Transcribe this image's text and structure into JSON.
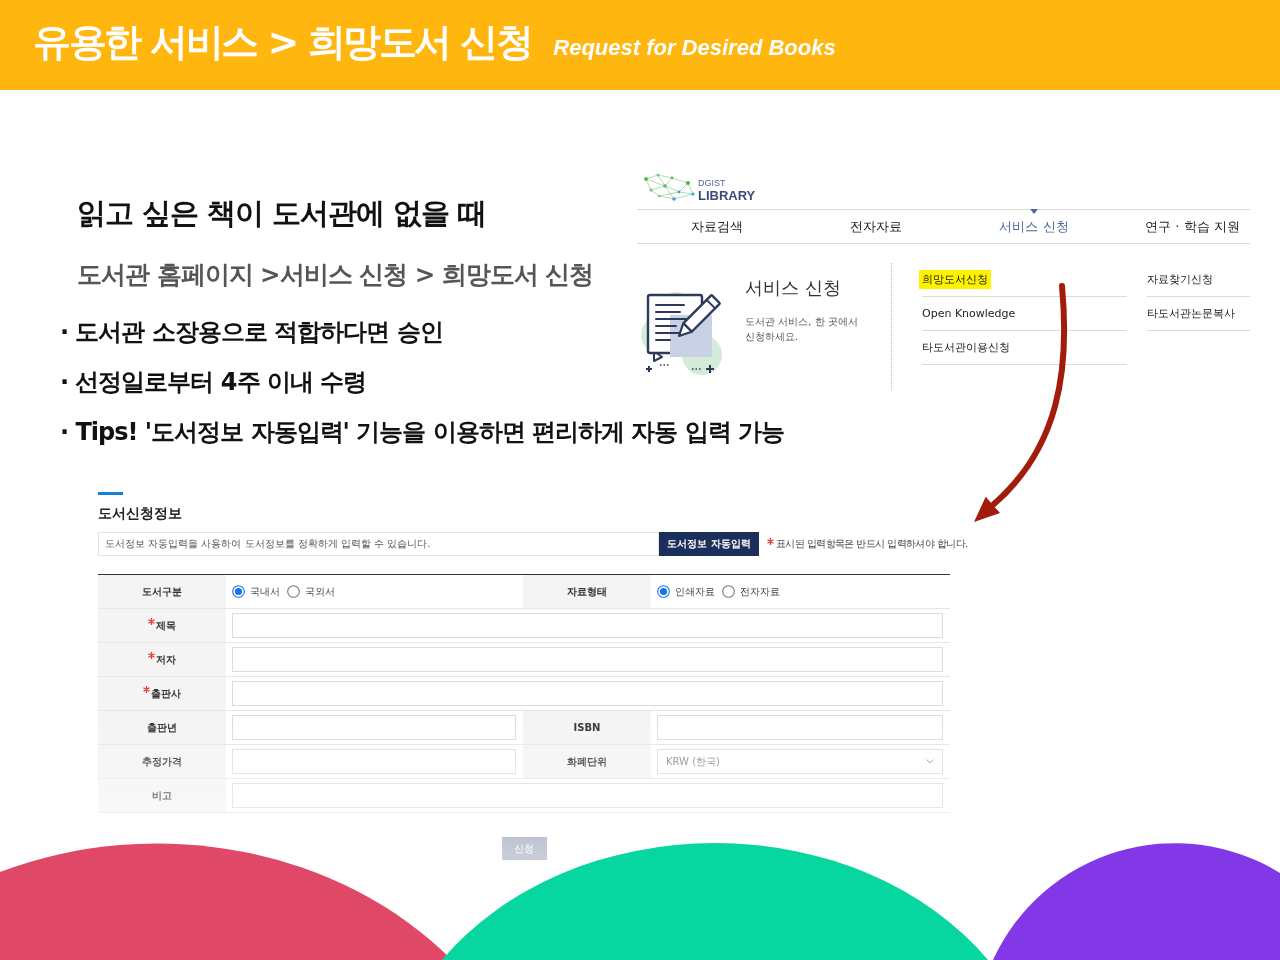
{
  "header": {
    "title": "유용한 서비스 > 희망도서 신청",
    "subtitle": "Request for Desired Books"
  },
  "intro": {
    "heading": "읽고 싶은 책이 도서관에 없을 때",
    "path": "도서관 홈페이지 >서비스 신청 > 희망도서 신청",
    "bullets": [
      "· 도서관 소장용으로 적합하다면 승인",
      "· 선정일로부터 4주 이내 수령",
      "· Tips! '도서정보 자동입력' 기능을 이용하면 편리하게 자동 입력 가능"
    ]
  },
  "library_nav": {
    "logo": {
      "top": "DGIST",
      "bottom": "LIBRARY"
    },
    "tabs": [
      {
        "label": "자료검색",
        "selected": false
      },
      {
        "label": "전자자료",
        "selected": false
      },
      {
        "label": "서비스 신청",
        "selected": true
      },
      {
        "label": "연구 · 학습 지원",
        "selected": false
      }
    ],
    "panel": {
      "title": "서비스 신청",
      "description": [
        "도서관 서비스, 한 곳에서",
        "신청하세요."
      ],
      "columns": [
        {
          "links": [
            {
              "label": "희망도서신청",
              "highlighted": true
            },
            {
              "label": "Open Knowledge",
              "highlighted": false
            },
            {
              "label": "타도서관이용신청",
              "highlighted": false
            }
          ]
        },
        {
          "links": [
            {
              "label": "자료찾기신청",
              "highlighted": false
            },
            {
              "label": "타도서관논문복사",
              "highlighted": false
            }
          ]
        }
      ]
    }
  },
  "form": {
    "title": "도서신청정보",
    "autofill": {
      "notice": "도서정보 자동입력을 사용하여 도서정보를 정확하게 입력할 수 있습니다.",
      "button": "도서정보 자동입력"
    },
    "required_note": "표시된 입력항목은 반드시 입력하셔야 합니다.",
    "rows": [
      {
        "kind": "choices",
        "cells": [
          {
            "label": "도서구분",
            "options": [
              {
                "label": "국내서",
                "selected": true
              },
              {
                "label": "국외서",
                "selected": false
              }
            ]
          },
          {
            "label": "자료형태",
            "options": [
              {
                "label": "인쇄자료",
                "selected": true
              },
              {
                "label": "전자자료",
                "selected": false
              }
            ]
          }
        ]
      },
      {
        "kind": "wide",
        "label": "제목",
        "required": true
      },
      {
        "kind": "wide",
        "label": "저자",
        "required": true
      },
      {
        "kind": "wide",
        "label": "출판사",
        "required": true
      },
      {
        "kind": "split",
        "cells": [
          {
            "label": "출판년",
            "kind": "text"
          },
          {
            "label": "ISBN",
            "kind": "text"
          }
        ]
      },
      {
        "kind": "split",
        "cells": [
          {
            "label": "추정가격",
            "kind": "text"
          },
          {
            "label": "화폐단위",
            "kind": "select",
            "value": "KRW (한국)"
          }
        ]
      },
      {
        "kind": "wide",
        "label": "비고",
        "required": false
      }
    ],
    "submit": "신청"
  }
}
